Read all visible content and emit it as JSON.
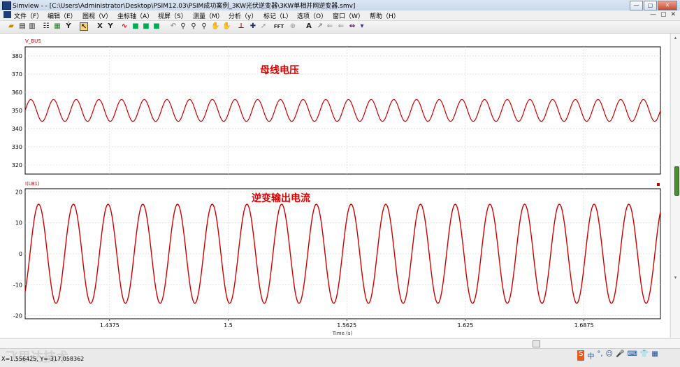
{
  "window": {
    "title": "Simview - - [C:\\Users\\Administrator\\Desktop\\PSIM12.03\\PSIM成功案例_3KW光伏逆变器\\3KW单相并网逆变器.smv]",
    "buttons": [
      "—",
      "▢",
      "✕"
    ]
  },
  "menu": {
    "items": [
      "文件（F）",
      "编辑（E）",
      "图视（V）",
      "坐标轴（A）",
      "视屏（S）",
      "测量（M）",
      "分析（y）",
      "标记（L）",
      "选项（O）",
      "窗口（W）",
      "帮助（H）"
    ],
    "mdi_buttons": [
      "—",
      "▢",
      "✕"
    ]
  },
  "toolbar": {
    "x_label": "X",
    "y_label": "Y",
    "fft_label": "FFT",
    "a_label": "A"
  },
  "chart_data": [
    {
      "type": "line",
      "series_label": "V_BUS",
      "annotation": "母线电压",
      "ylim": [
        315,
        385
      ],
      "y_ticks": [
        "380",
        "370",
        "360",
        "350",
        "340",
        "330",
        "320"
      ],
      "grid": true,
      "color": "#cc0000",
      "waveform": {
        "mean": 350,
        "amplitude": 6,
        "cycles": 28
      }
    },
    {
      "type": "line",
      "series_label": "I(LB1)",
      "annotation": "逆变输出电流",
      "ylim": [
        -21,
        21
      ],
      "y_ticks": [
        "20",
        "10",
        "0",
        "-10",
        "-20"
      ],
      "grid": true,
      "color": "#cc0000",
      "waveform": {
        "mean": 0,
        "amplitude": 16,
        "cycles": 18.3,
        "phase_deg": -50
      }
    }
  ],
  "x_axis": {
    "ticks": [
      "1.4375",
      "1.5",
      "1.5625",
      "1.625",
      "1.6875"
    ],
    "label": "Time (s)",
    "xlim": [
      1.393,
      1.7278
    ]
  },
  "status": {
    "coords": "X=1.556425, Y=-317.058362",
    "watermark": "飞思达技术"
  },
  "tray": {
    "items": [
      "中",
      "°,",
      "☺",
      "🎤",
      "⌨",
      "👕",
      "▦"
    ]
  }
}
